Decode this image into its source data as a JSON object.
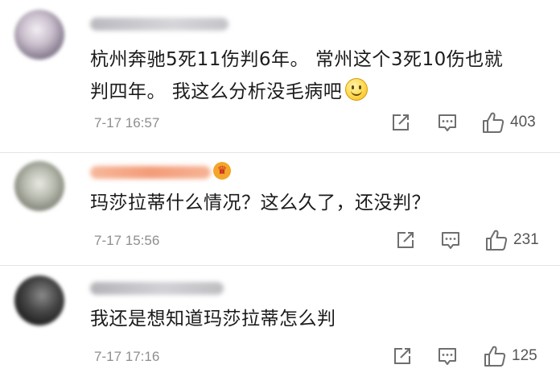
{
  "comments": [
    {
      "text_line1": "杭州奔驰5死11伤判6年。  常州这个3死10伤也就",
      "text_line2": "判四年。 我这么分析没毛病吧",
      "emoji": "smiley-emoji",
      "time": "7-17 16:57",
      "likes": "403",
      "avatar_colors": [
        "#9a8fa0",
        "#d9d2db"
      ],
      "username_color": "#c8c8cc"
    },
    {
      "text_line1": "玛莎拉蒂什么情况？这么久了，还没判？",
      "badge": "crown-emoji",
      "time": "7-17 15:56",
      "likes": "231",
      "avatar_colors": [
        "#8d8f84",
        "#cfd1c6"
      ],
      "username_color": "#f2a07e"
    },
    {
      "text_line1": "我还是想知道玛莎拉蒂怎么判",
      "time": "7-17 17:16",
      "likes": "125",
      "avatar_colors": [
        "#2c2c2c",
        "#6e6e6e"
      ],
      "username_color": "#c0c0c4"
    }
  ],
  "icons": {
    "repost": "repost-icon",
    "reply": "comment-icon",
    "like": "thumbs-up-icon"
  }
}
